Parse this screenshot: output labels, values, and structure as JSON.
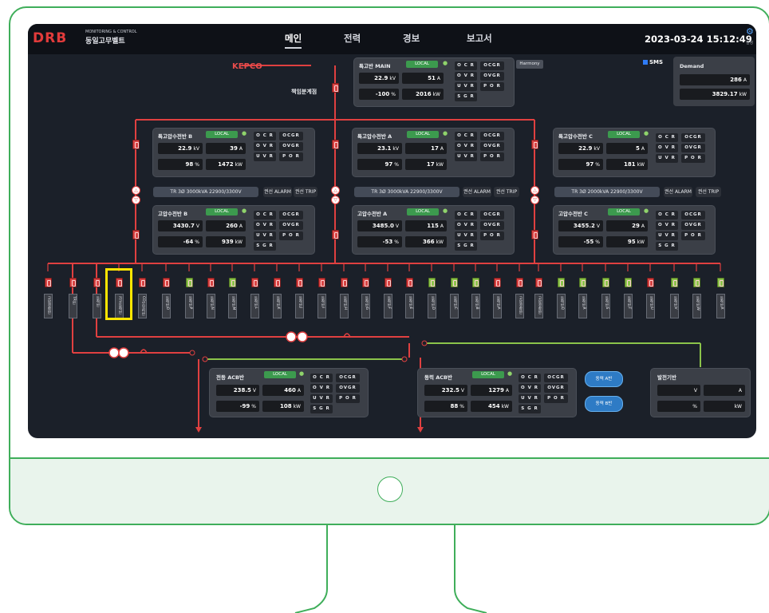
{
  "nav": {
    "items": [
      "메인",
      "전력",
      "경보",
      "보고서"
    ]
  },
  "header": {
    "logo": "DRB",
    "subtitle": "MONITORING & CONTROL",
    "company": "동일고무벨트",
    "datetime": "2023-03-24 15:12:49",
    "settings_label": "설정"
  },
  "kepco": {
    "label": "KEPCO",
    "point_label": "책임분계점"
  },
  "harmony": "Harmony",
  "sms": "SMS",
  "demand": {
    "title": "Demand",
    "current": "286",
    "current_unit": "A",
    "power": "3829.17",
    "power_unit": "kW"
  },
  "faults": {
    "ocr": "O C R",
    "ocgr": "OCGR",
    "ovr": "O V R",
    "ovgr": "OVGR",
    "uvr": "U V R",
    "por": "P O R",
    "sgr": "S G R"
  },
  "status": {
    "local": "LOCAL"
  },
  "panels": {
    "main": {
      "title": "특고반 MAIN",
      "v": "22.9",
      "v_unit": "kV",
      "i": "51",
      "i_unit": "A",
      "pf": "-100",
      "pf_unit": "%",
      "p": "2016",
      "p_unit": "kW"
    },
    "hv_b": {
      "title": "특고압수전반 B",
      "v": "22.9",
      "v_unit": "kV",
      "i": "39",
      "i_unit": "A",
      "pf": "98",
      "pf_unit": "%",
      "p": "1472",
      "p_unit": "kW"
    },
    "hv_a": {
      "title": "특고압수전반 A",
      "v": "23.1",
      "v_unit": "kV",
      "i": "17",
      "i_unit": "A",
      "pf": "97",
      "pf_unit": "%",
      "p": "17",
      "p_unit": "kW"
    },
    "hv_c": {
      "title": "특고압수전반 C",
      "v": "22.9",
      "v_unit": "kV",
      "i": "5",
      "i_unit": "A",
      "pf": "97",
      "pf_unit": "%",
      "p": "181",
      "p_unit": "kW"
    },
    "mv_b": {
      "title": "고압수전반 B",
      "v": "3430.7",
      "v_unit": "V",
      "i": "260",
      "i_unit": "A",
      "pf": "-64",
      "pf_unit": "%",
      "p": "939",
      "p_unit": "kW"
    },
    "mv_a": {
      "title": "고압수전반 A",
      "v": "3485.0",
      "v_unit": "V",
      "i": "115",
      "i_unit": "A",
      "pf": "-53",
      "pf_unit": "%",
      "p": "366",
      "p_unit": "kW"
    },
    "mv_c": {
      "title": "고압수전반 C",
      "v": "3455.2",
      "v_unit": "V",
      "i": "29",
      "i_unit": "A",
      "pf": "-55",
      "pf_unit": "%",
      "p": "95",
      "p_unit": "kW"
    },
    "light_acb": {
      "title": "전등 ACB반",
      "v": "238.5",
      "v_unit": "V",
      "i": "460",
      "i_unit": "A",
      "pf": "-99",
      "pf_unit": "%",
      "p": "108",
      "p_unit": "kW"
    },
    "power_acb": {
      "title": "동력 ACB반",
      "v": "232.5",
      "v_unit": "V",
      "i": "1279",
      "i_unit": "A",
      "pf": "88",
      "pf_unit": "%",
      "p": "454",
      "p_unit": "kW"
    },
    "gen": {
      "title": "발전기반",
      "v_unit": "V",
      "i_unit": "A",
      "pf_unit": "%",
      "p_unit": "kW"
    }
  },
  "transformers": {
    "b": {
      "rating": "TR 3Ø 3000kVA  22900/3300V",
      "alarm": "권선 ALARM",
      "trip": "권선 TRIP"
    },
    "a": {
      "rating": "TR 3Ø 3000kVA  22900/3300V",
      "alarm": "권선 ALARM",
      "trip": "권선 TRIP"
    },
    "c": {
      "rating": "TR 3Ø 2000kVA  22900/3300V",
      "alarm": "권선 ALARM",
      "trip": "권선 TRIP"
    }
  },
  "power_buttons": {
    "a": "동력 A반",
    "b": "동력 B반"
  },
  "feeders": [
    {
      "label": "고압결합반",
      "state": "red"
    },
    {
      "label": "TR반",
      "state": "red"
    },
    {
      "label": "동력반",
      "state": "red"
    },
    {
      "label": "가공동력반",
      "state": "red"
    },
    {
      "label": "CO보일러반",
      "state": "red"
    },
    {
      "label": "동력반O",
      "state": "red"
    },
    {
      "label": "동력반P",
      "state": "green"
    },
    {
      "label": "동력반N",
      "state": "red"
    },
    {
      "label": "동력반M",
      "state": "green"
    },
    {
      "label": "동력반L",
      "state": "red"
    },
    {
      "label": "동력반K",
      "state": "red"
    },
    {
      "label": "동력반J",
      "state": "red"
    },
    {
      "label": "동력반I",
      "state": "red"
    },
    {
      "label": "동력반H",
      "state": "red"
    },
    {
      "label": "동력반G",
      "state": "red"
    },
    {
      "label": "동력반F",
      "state": "red"
    },
    {
      "label": "동력반E",
      "state": "red"
    },
    {
      "label": "동력반D",
      "state": "green"
    },
    {
      "label": "동력반C",
      "state": "green"
    },
    {
      "label": "동력반B",
      "state": "green"
    },
    {
      "label": "동력반A",
      "state": "red"
    },
    {
      "label": "고압결합반",
      "state": "red"
    },
    {
      "label": "고압결합반",
      "state": "red"
    },
    {
      "label": "동력반Q",
      "state": "green"
    },
    {
      "label": "동력반R",
      "state": "green"
    },
    {
      "label": "동력반S",
      "state": "green"
    },
    {
      "label": "동력반T",
      "state": "green"
    },
    {
      "label": "동력반U",
      "state": "red"
    },
    {
      "label": "동력반V",
      "state": "green"
    },
    {
      "label": "동력반W",
      "state": "green"
    },
    {
      "label": "동력반X",
      "state": "green"
    }
  ],
  "colors": {
    "line_red": "#e04040",
    "line_green": "#8bc34a",
    "highlight": "#ffe600",
    "frame": "#3fae5a"
  }
}
